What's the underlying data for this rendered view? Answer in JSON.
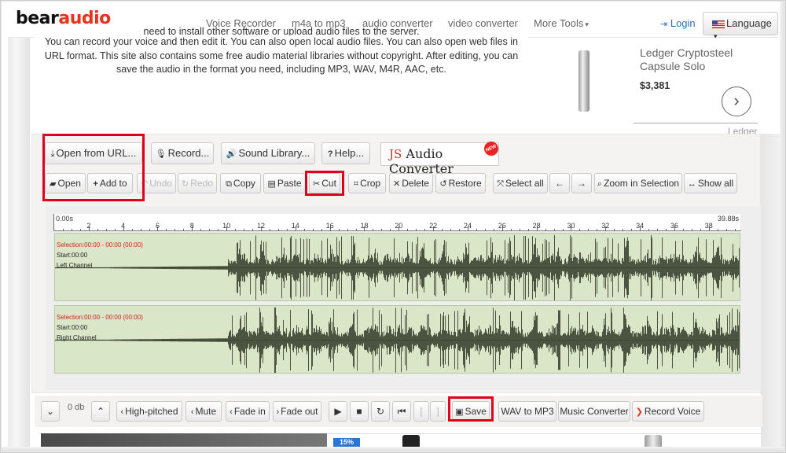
{
  "nav": {
    "logo_part1": "bear",
    "logo_part2": "audio",
    "links": [
      "Voice Recorder",
      "m4a to mp3",
      "audio converter",
      "video converter",
      "More Tools"
    ],
    "login": "Login",
    "language": "Language"
  },
  "intro": {
    "line0": "need to install other software or upload audio files to the server.",
    "text": "You can record your voice and then edit it. You can also open local audio files. You can also open web files in URL format. This site also contains some free audio material libraries without copyright. After editing, you can save the audio in the format you need, including MP3, WAV, M4R, AAC, etc."
  },
  "ad": {
    "title": "Ledger Cryptosteel Capsule Solo",
    "price": "$3,381",
    "brand": "Ledger"
  },
  "toolbar_top": {
    "open_url": "Open from URL...",
    "record": "Record...",
    "sound_library": "Sound Library...",
    "help": "Help...",
    "logo_js": "JS",
    "logo_text": "Audio Converter",
    "logo_badge": "NEW"
  },
  "toolbar_edit": {
    "open": "Open",
    "add_to": "Add to",
    "undo": "Undo",
    "redo": "Redo",
    "copy": "Copy",
    "paste": "Paste",
    "cut": "Cut",
    "crop": "Crop",
    "delete": "Delete",
    "restore": "Restore",
    "select_all": "Select all",
    "arrow_left": "←",
    "arrow_right": "→",
    "zoom_in_selection": "Zoom in Selection",
    "show_all": "Show all"
  },
  "timeline": {
    "start": "0.00s",
    "end": "39.88s",
    "ticks": [
      "2",
      "4",
      "6",
      "8",
      "10",
      "12",
      "14",
      "16",
      "18",
      "20",
      "22",
      "24",
      "26",
      "28",
      "30",
      "32",
      "34",
      "36",
      "38"
    ]
  },
  "channels": [
    {
      "selection": "Selection:00:00 - 00:00 (00:00)",
      "start": "Start:00:00",
      "name": "Left Channel"
    },
    {
      "selection": "Selection:00:00 - 00:00 (00:00)",
      "start": "Start:00:00",
      "name": "Right Channel"
    }
  ],
  "bottom_bar": {
    "down": "⌄",
    "db": "0 db",
    "up": "⌃",
    "high_pitched": "High-pitched",
    "mute": "Mute",
    "fade_in": "Fade in",
    "fade_out": "Fade out",
    "play": "▶",
    "stop": "■",
    "loop": "↻",
    "skip_start": "⏮",
    "bracket_left": "[",
    "bracket_right": "]",
    "save": "Save",
    "wav_to_mp3": "WAV to MP3",
    "music_converter": "Music Converter",
    "record_voice": "Record Voice"
  },
  "strip": {
    "badge": "15%"
  },
  "colors": {
    "accent": "#e8331c",
    "link": "#2f6fbf",
    "highlight": "#e0001b",
    "waveform": "#4a5440",
    "wave_bg": "#d9e7c8"
  }
}
